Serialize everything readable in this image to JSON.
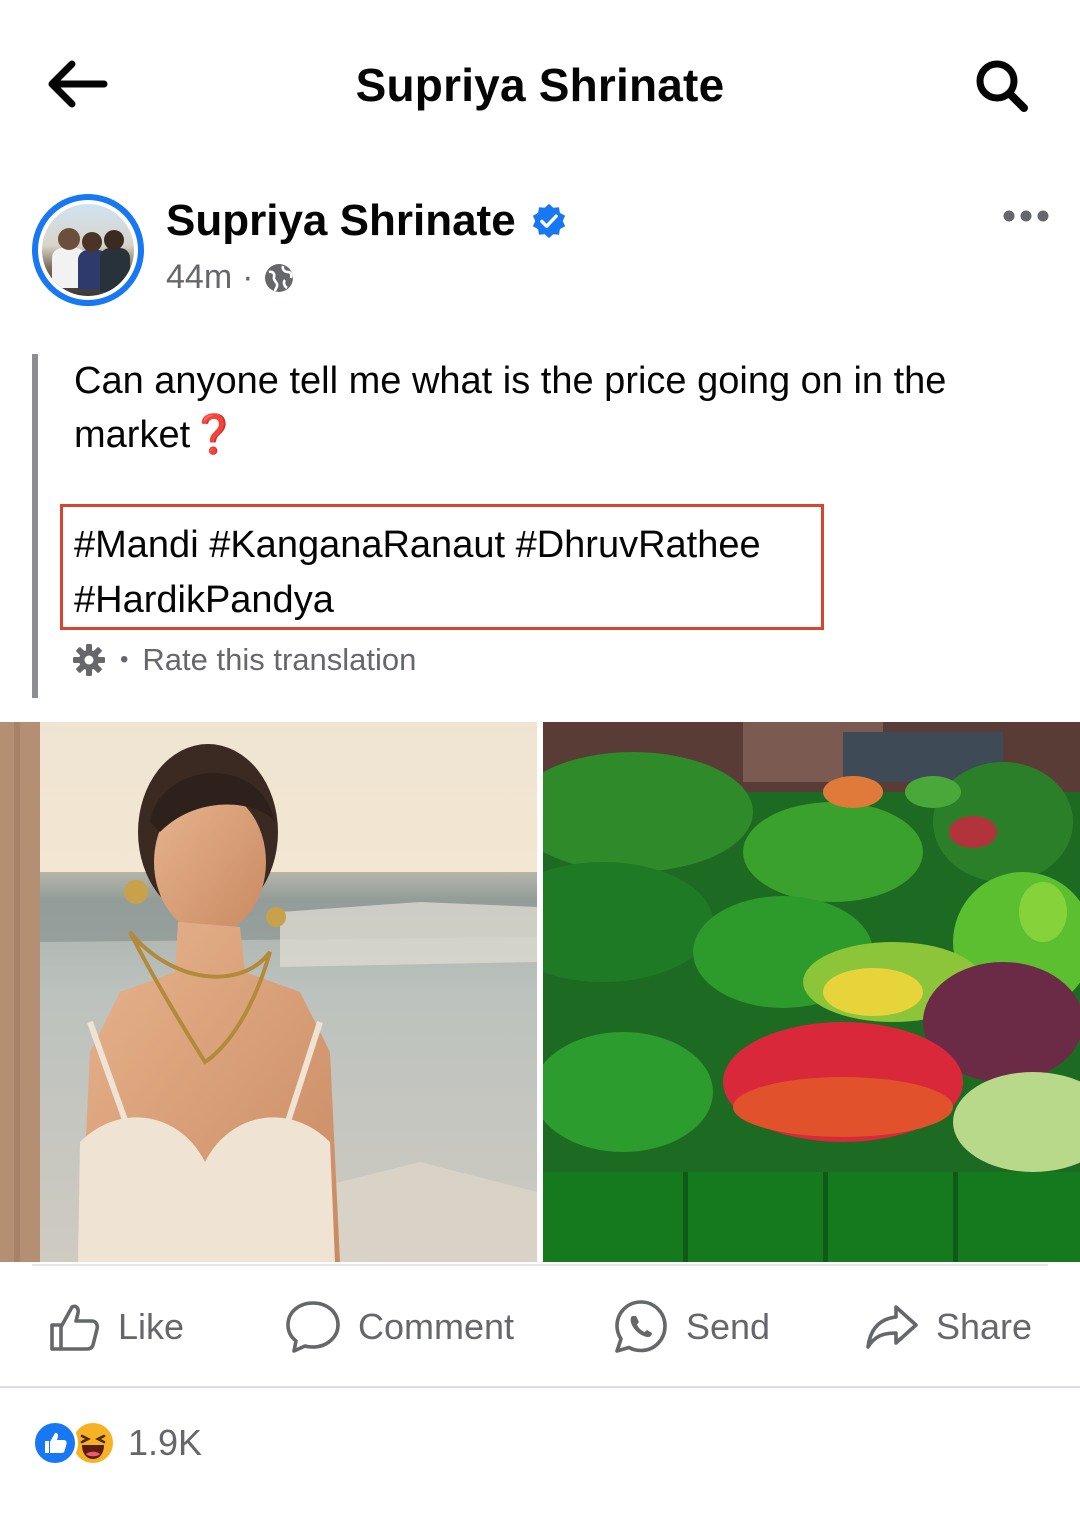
{
  "header": {
    "title": "Supriya Shrinate",
    "back_icon": "arrow-left-icon",
    "search_icon": "search-icon"
  },
  "post": {
    "author": "Supriya Shrinate",
    "verified": true,
    "timestamp": "44m",
    "separator": "·",
    "audience_icon": "globe-icon",
    "text": "Can anyone tell me what is the price going on in the market",
    "text_emoji": "❓",
    "hashtags": [
      "#Mandi",
      "#KanganaRanaut",
      "#DhruvRathee",
      "#HardikPandya"
    ],
    "translation_link": "Rate this translation",
    "images": [
      {
        "subject": "woman-portrait-photo"
      },
      {
        "subject": "vegetable-market-photo"
      }
    ]
  },
  "actions": {
    "like": "Like",
    "comment": "Comment",
    "send": "Send",
    "share": "Share"
  },
  "reactions": {
    "count": "1.9K",
    "types": [
      "like",
      "haha"
    ]
  },
  "colors": {
    "accent": "#1877f2",
    "highlight_box": "#d9442c",
    "secondary_text": "#65676b"
  }
}
